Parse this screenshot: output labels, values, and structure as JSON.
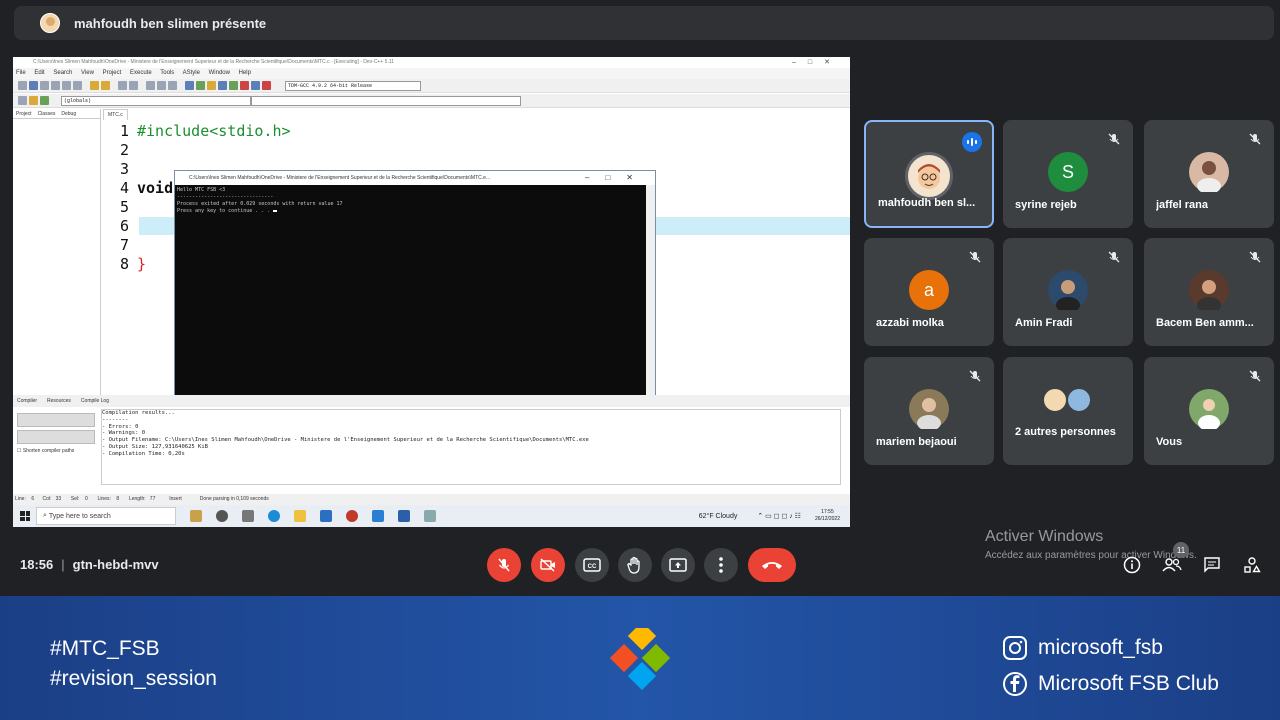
{
  "presenter_bar": {
    "text": "mahfoudh ben slimen présente"
  },
  "shared_screen": {
    "window_title": "C:\\Users\\Ines Slimen Mahfoudh\\OneDrive - Ministere de l'Enseignement Superieur et de la Recherche Scientifique\\Documents\\MTC.c - [Executing] - Dev-C++ 5.11",
    "menu": [
      "File",
      "Edit",
      "Search",
      "View",
      "Project",
      "Execute",
      "Tools",
      "AStyle",
      "Window",
      "Help"
    ],
    "compiler": "TDM-GCC 4.9.2 64-bit Release",
    "globals": "(globals)",
    "left_tabs": [
      "Project",
      "Classes",
      "Debug"
    ],
    "editor_tab": "MTC.c",
    "line_numbers": [
      "1",
      "2",
      "3",
      "4",
      "5",
      "6",
      "7",
      "8"
    ],
    "code": {
      "line1": "#include<stdio.h>",
      "line4": "void",
      "line8": "}"
    },
    "console": {
      "title": "C:\\Users\\Ines Slimen Mahfoudh\\OneDrive - Ministere de l'Enseignement Superieur et de la Recherche Scientifique\\Documents\\MTC.e...",
      "line1": "Hello MTC FSB <3",
      "line2": "--------------------------------",
      "line3": "Process exited after 0.029 seconds with return value 17",
      "line4": "Press any key to continue . . . "
    },
    "bottom_tabs": [
      "Compiler",
      "Resources",
      "Compile Log"
    ],
    "shorten_label": "Shorten compiler paths",
    "log": {
      "l1": "Compilation results...",
      "l2": "--------",
      "l3": "- Errors: 0",
      "l4": "- Warnings: 0",
      "l5": "- Output Filename: C:\\Users\\Ines Slimen Mahfoudh\\OneDrive - Ministere de l'Enseignement Superieur et de la Recherche Scientifique\\Documents\\MTC.exe",
      "l6": "- Output Size: 127,931640625 KiB",
      "l7": "- Compilation Time: 0,20s"
    },
    "statusbar": "Line:    6      Col:   33       Sel:    0       Lines:    8       Length:   77          Insert             Done parsing in 0,109 seconds",
    "taskbar": {
      "search_placeholder": "Type here to search",
      "weather": "62°F  Cloudy",
      "time": "17:55",
      "date": "26/12/2022"
    }
  },
  "participants": [
    {
      "name": "mahfoudh ben sl...",
      "initial": "",
      "speaking": true
    },
    {
      "name": "syrine rejeb",
      "initial": "S",
      "color": "#1e8e3e"
    },
    {
      "name": "jaffel rana",
      "initial": ""
    },
    {
      "name": "azzabi molka",
      "initial": "a",
      "color": "#e8710a"
    },
    {
      "name": "Amin Fradi",
      "initial": ""
    },
    {
      "name": "Bacem Ben amm...",
      "initial": ""
    },
    {
      "name": "mariem bejaoui",
      "initial": ""
    },
    {
      "name": "2 autres personnes",
      "initial": ""
    },
    {
      "name": "Vous",
      "initial": ""
    }
  ],
  "meeting": {
    "time": "18:56",
    "code": "gtn-hebd-mvv",
    "participant_count": "11"
  },
  "activate_windows": {
    "title": "Activer Windows",
    "subtitle": "Accédez aux paramètres pour activer Windows."
  },
  "footer": {
    "hashtag1": "#MTC_FSB",
    "hashtag2": "#revision_session",
    "instagram": "microsoft_fsb",
    "facebook": "Microsoft FSB Club"
  },
  "colors": {
    "meet_bg": "#202124",
    "tile_bg": "#3c4043",
    "danger": "#ea4335",
    "accent": "#8ab4f8",
    "footer": "#2355a8"
  }
}
